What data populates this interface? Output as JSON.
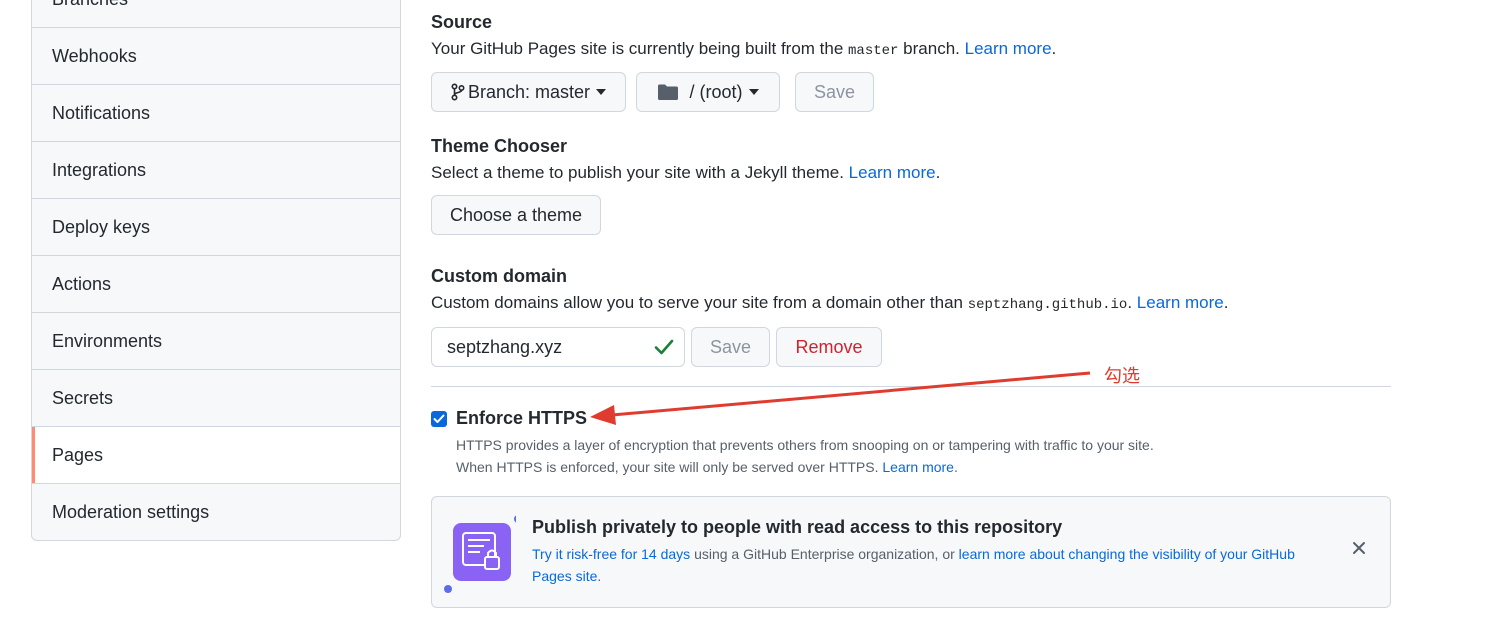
{
  "sidebar": {
    "items": [
      {
        "label": "Branches"
      },
      {
        "label": "Webhooks"
      },
      {
        "label": "Notifications"
      },
      {
        "label": "Integrations"
      },
      {
        "label": "Deploy keys"
      },
      {
        "label": "Actions"
      },
      {
        "label": "Environments"
      },
      {
        "label": "Secrets"
      },
      {
        "label": "Pages",
        "selected": true
      },
      {
        "label": "Moderation settings"
      }
    ]
  },
  "source": {
    "title": "Source",
    "desc_before": "Your GitHub Pages site is currently being built from the ",
    "desc_code": "master",
    "desc_after": " branch. ",
    "learn_more": "Learn more",
    "period": ".",
    "branch_label": "Branch: master",
    "folder_label": "/ (root)",
    "save_label": "Save"
  },
  "theme": {
    "title": "Theme Chooser",
    "desc": "Select a theme to publish your site with a Jekyll theme. ",
    "learn_more": "Learn more",
    "period": ".",
    "button_label": "Choose a theme"
  },
  "custom_domain": {
    "title": "Custom domain",
    "desc_before": "Custom domains allow you to serve your site from a domain other than ",
    "desc_code": "septzhang.github.io",
    "desc_after": ". ",
    "learn_more": "Learn more",
    "period": ".",
    "input_value": "septzhang.xyz",
    "save_label": "Save",
    "remove_label": "Remove"
  },
  "https": {
    "checked": true,
    "title": "Enforce HTTPS",
    "desc_line1": "HTTPS provides a layer of encryption that prevents others from snooping on or tampering with traffic to your site.",
    "desc_line2": "When HTTPS is enforced, your site will only be served over HTTPS. ",
    "learn_more": "Learn more",
    "period": "."
  },
  "banner": {
    "title": "Publish privately to people with read access to this repository",
    "link1": "Try it risk-free for 14 days",
    "middle": " using a GitHub Enterprise organization, or ",
    "link2": "learn more about changing the visibility of your GitHub Pages site",
    "period": "."
  },
  "annotation": {
    "text": "勾选",
    "color": "#e03b2f"
  },
  "colors": {
    "link": "#0969da",
    "accent_selected": "#fd8c73",
    "success": "#1a7f37",
    "danger": "#cf222e",
    "banner_icon": "#8a63f5"
  }
}
